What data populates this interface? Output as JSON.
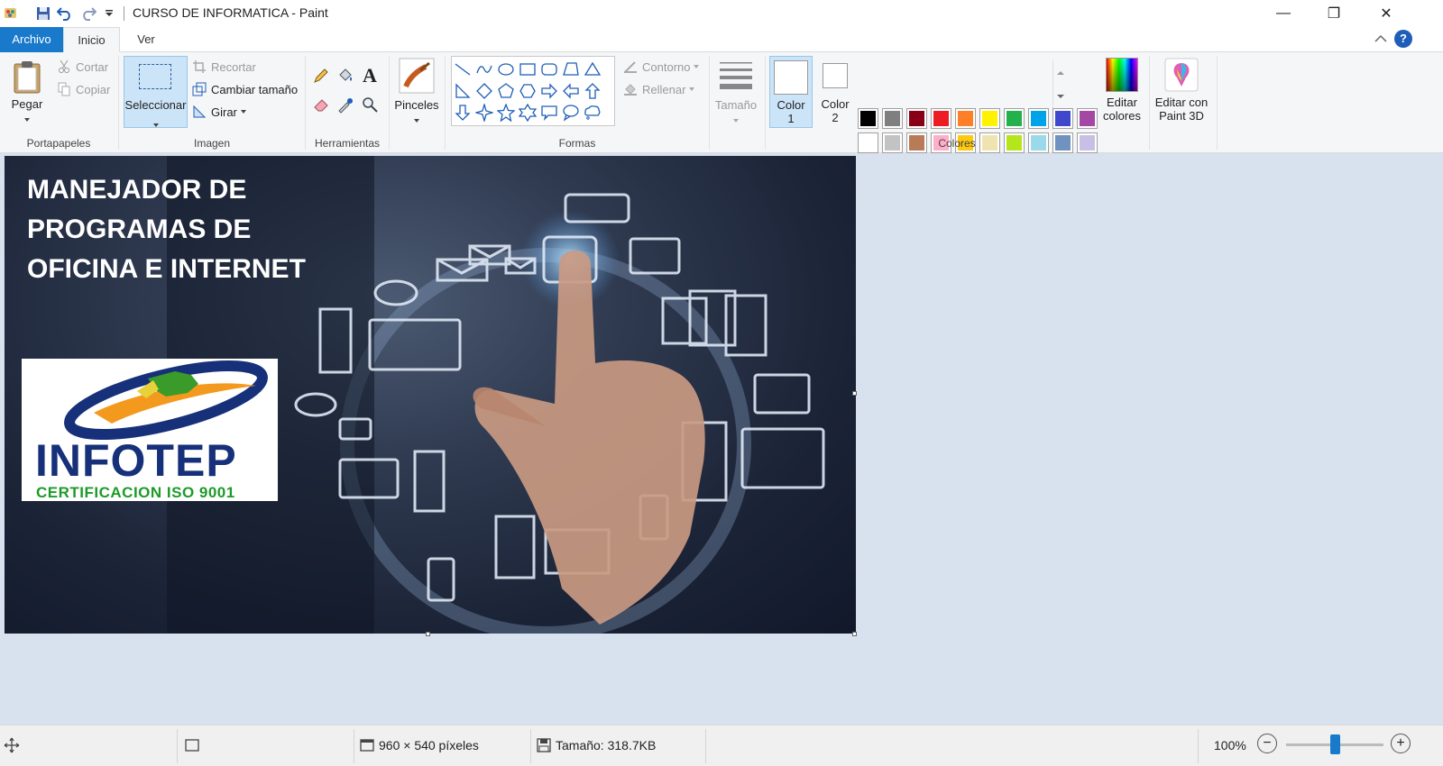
{
  "window": {
    "title": "CURSO DE INFORMATICA - Paint",
    "minimize_label": "—",
    "restore_label": "❐",
    "close_label": "✕"
  },
  "tabs": [
    {
      "label": "Archivo",
      "active": false
    },
    {
      "label": "Inicio",
      "active": true
    },
    {
      "label": "Ver",
      "active": false
    }
  ],
  "ribbon": {
    "portapapeles": {
      "label": "Portapapeles",
      "paste_label": "Pegar",
      "cut_label": "Cortar",
      "copy_label": "Copiar"
    },
    "imagen": {
      "label": "Imagen",
      "select_label": "Seleccionar",
      "crop_label": "Recortar",
      "resize_label": "Cambiar tamaño",
      "rotate_label": "Girar"
    },
    "herramientas": {
      "label": "Herramientas"
    },
    "pinceles": {
      "label": "Pinceles"
    },
    "formas": {
      "label": "Formas",
      "outline_label": "Contorno",
      "fill_label": "Rellenar"
    },
    "tamano": {
      "label": "Tamaño"
    },
    "colores": {
      "label": "Colores",
      "color1_label": "Color",
      "color1_num": "1",
      "color2_label": "Color",
      "color2_num": "2",
      "edit_colors_line1": "Editar",
      "edit_colors_line2": "colores",
      "paint3d_line1": "Editar con",
      "paint3d_line2": "Paint 3D",
      "palette_row1": [
        "#000000",
        "#7f7f7f",
        "#880015",
        "#ed1c24",
        "#ff7f27",
        "#fff200",
        "#22b14c",
        "#00a2e8",
        "#3f48cc",
        "#a349a4"
      ],
      "palette_row2": [
        "#ffffff",
        "#c3c3c3",
        "#b97a57",
        "#ffaec9",
        "#ffc90e",
        "#efe4b0",
        "#b5e61d",
        "#99d9ea",
        "#7092be",
        "#c8bfe7"
      ]
    }
  },
  "canvas": {
    "title_line1": "MANEJADOR DE",
    "title_line2": "PROGRAMAS DE",
    "title_line3": "OFICINA E INTERNET",
    "logo_name": "INFOTEP",
    "logo_sub": "CERTIFICACION ISO 9001"
  },
  "status": {
    "dimensions": "960 × 540 píxeles",
    "size": "Tamaño: 318.7KB",
    "zoom": "100%",
    "zoom_level": 1.0
  },
  "colors": {
    "accent": "#1979ca",
    "workspace": "#d8e1ee",
    "selection": "#cce4f7"
  }
}
